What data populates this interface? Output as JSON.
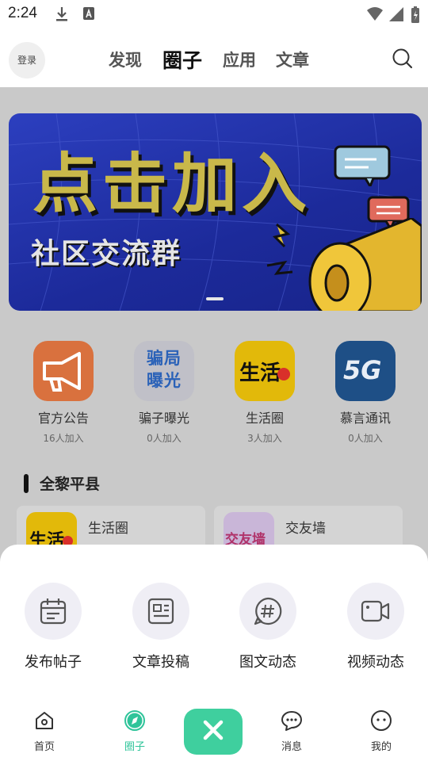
{
  "status_bar": {
    "time": "2:24"
  },
  "header": {
    "login_label": "登录",
    "tabs": [
      {
        "label": "发现"
      },
      {
        "label": "圈子"
      },
      {
        "label": "应用"
      },
      {
        "label": "文章"
      }
    ],
    "active_tab": "圈子"
  },
  "banner": {
    "headline": "点击加入",
    "subtitle": "社区交流群"
  },
  "circles": [
    {
      "name": "官方公告",
      "count": "16人加入",
      "icon": "megaphone-icon"
    },
    {
      "name": "骗子曝光",
      "count": "0人加入",
      "icon_text": "骗局曝光"
    },
    {
      "name": "生活圈",
      "count": "3人加入",
      "icon_text": "生活"
    },
    {
      "name": "慕言通讯",
      "count": "0人加入",
      "icon_text": "5G"
    }
  ],
  "section": {
    "title": "全黎平县"
  },
  "cards": [
    {
      "name": "生活圈",
      "icon_text": "生活"
    },
    {
      "name": "交友墙",
      "icon_text": "交友墙"
    }
  ],
  "sheet": {
    "actions": [
      {
        "label": "发布帖子",
        "icon": "calendar-note-icon"
      },
      {
        "label": "文章投稿",
        "icon": "document-icon"
      },
      {
        "label": "图文动态",
        "icon": "hashtag-icon"
      },
      {
        "label": "视频动态",
        "icon": "video-camera-icon"
      }
    ]
  },
  "nav": {
    "items": [
      {
        "label": "首页"
      },
      {
        "label": "圈子"
      },
      {
        "label": "消息"
      },
      {
        "label": "我的"
      }
    ],
    "accent_color": "#3fcf9e"
  }
}
